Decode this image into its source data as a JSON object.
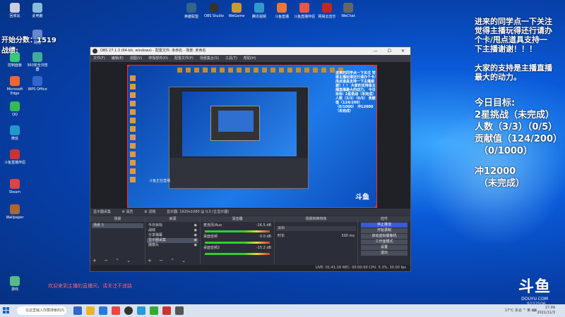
{
  "overlay": {
    "line1": "进来的同学点一下关注",
    "line2": "觉得主播玩得还行请办",
    "line3": "个卡/甩点道具支持一",
    "line4": "下主播谢谢！！！",
    "support1": "大家的支持是主播直播",
    "support2": "最大的动力。",
    "goal_title": "今日目标:",
    "goal_star": "2星挑战（未完成）",
    "goal_people": "人数（3/3）（0/5）",
    "goal_contrib": "贡献值（124/200）",
    "goal_contrib2": "（0/1000）",
    "goal_rush": "冲12000",
    "goal_rush2": "（未完成）"
  },
  "counter": "开始分数：1519",
  "counter2": "战绩:",
  "chat_line": "欢迎来到主播的直播间，请关注不迷路",
  "obs": {
    "title": "OBS 27.1.3 (64-bit, windows) - 配置文件: 未命名 - 场景: 未命名",
    "win_controls": "— ☐ ✕",
    "menu": [
      "文件(F)",
      "编辑(E)",
      "视图(V)",
      "停靠部件(D)",
      "配置文件(P)",
      "场景集合(S)",
      "工具(T)",
      "帮助(H)"
    ],
    "mini_overlay": "进来的同学点一下关注 觉得主播玩得还行请办个卡/甩点道具支持一下主播谢谢！！！ 大家的支持是主播直播最大的动力。 今日目标: 2星挑战（未完成） 人数（3/3）（0/5） 贡献值（124/200）（0/1000） 冲12000（未完成）",
    "mini_logo": "斗鱼",
    "stream_label": "斗鱼正在直播",
    "toolbar": [
      "显示器采集",
      "⚙ 属性",
      "⚙ 滤镜",
      "显示器: 1920x1080 @ 0,0 (主显示器)"
    ],
    "scenes_header": "场景",
    "scenes": [
      "场景 3"
    ],
    "sources_header": "来源",
    "sources": [
      "今日目标",
      "战绩",
      "分享弹幕",
      "显示器采集",
      "摄像头"
    ],
    "mixer_header": "混音器",
    "mixer": [
      {
        "name": "麦克风/Aux",
        "db": "-16.5 dB"
      },
      {
        "name": "桌面音频",
        "db": "0.0 dB"
      },
      {
        "name": "桌面音频2",
        "db": "-15.2 dB"
      }
    ],
    "transitions_header": "场景转换特效",
    "transition_name": "淡出",
    "duration_label": "时长",
    "duration_value": "300 ms",
    "controls_header": "控件",
    "controls": [
      "停止推流",
      "开始录制",
      "启动虚拟摄像机",
      "工作室模式",
      "设置",
      "退出"
    ],
    "status": "LIVE: 01:41:16   REC: 00:00:00   CPU: 5.3%, 30.00 fps",
    "dock_foot": "+ − ⌃ ⌄"
  },
  "desktop_icons": [
    "回收站",
    "此电脑",
    "网络",
    "控制面板",
    "360安全浏览器",
    "Microsoft Edge",
    "WPS Office",
    "QQ",
    "微信",
    "斗鱼直播伴侣",
    "Steam",
    "Wallpaper",
    "游戏"
  ],
  "top_icons": [
    "英雄联盟",
    "OBS Studio",
    "WeGame",
    "腾讯视频",
    "斗鱼直播",
    "斗鱼直播伴侣",
    "网易云音乐",
    "WeChat"
  ],
  "douyu": {
    "logo": "斗鱼",
    "domain": "DOUYU.COM",
    "room": "9232506"
  },
  "taskbar": {
    "search": "在这里输入你要搜索的内容",
    "tray": "17°C 多云 ^ 英 ⌨",
    "time": "17:09",
    "date": "2021/11/3"
  },
  "colors": {
    "accent": "#1a5fd0",
    "selection": "#e33"
  }
}
